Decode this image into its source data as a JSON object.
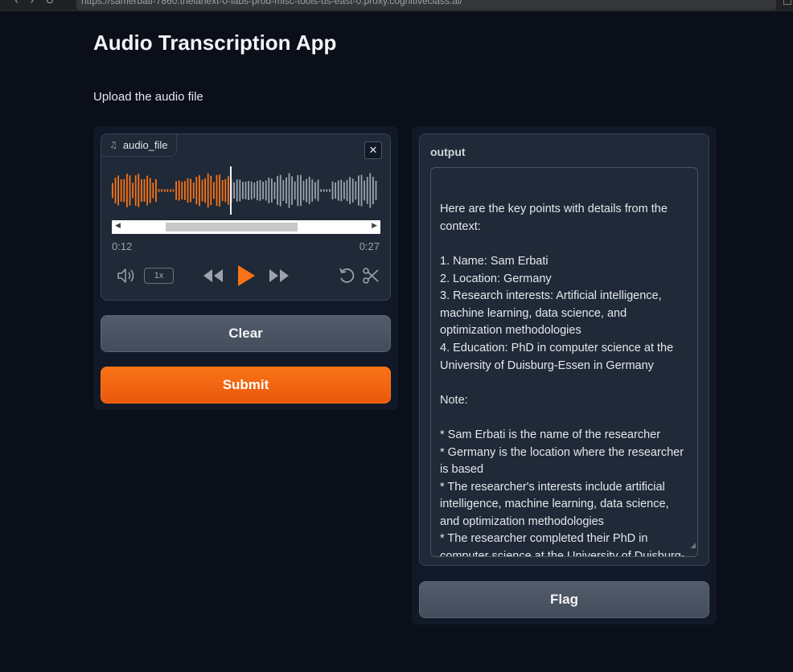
{
  "browser": {
    "url": "https://samerbati-7860.theianext-0-labs-prod-misc-tools-us-east-0.proxy.cognitiveclass.ai/"
  },
  "page": {
    "title": "Audio Transcription App",
    "description": "Upload the audio file"
  },
  "audio_input": {
    "label": "audio_file",
    "current_time": "0:12",
    "duration": "0:27",
    "playback_speed": "1x",
    "progress": 0.44,
    "colors": {
      "played": "#f97316",
      "unplayed": "#9ca3af"
    }
  },
  "buttons": {
    "clear": "Clear",
    "submit": "Submit",
    "flag": "Flag"
  },
  "output": {
    "label": "output",
    "text": "Here are the key points with details from the context:\n\n1. Name: Sam Erbati\n2. Location: Germany\n3. Research interests: Artificial intelligence, machine learning, data science, and optimization methodologies\n4. Education: PhD in computer science at the University of Duisburg-Essen in Germany\n\nNote:\n\n* Sam Erbati is the name of the researcher\n* Germany is the location where the researcher is based\n* The researcher's interests include artificial intelligence, machine learning, data science, and optimization methodologies\n* The researcher completed their PhD in computer science at the University of Duisburg-Essen in Germany."
  },
  "icons": {
    "audio_label": "music-note-icon",
    "close": "close-icon",
    "volume": "volume-icon",
    "rewind": "rewind-icon",
    "play": "play-icon",
    "forward": "fast-forward-icon",
    "undo": "undo-icon",
    "trim": "scissors-icon"
  }
}
